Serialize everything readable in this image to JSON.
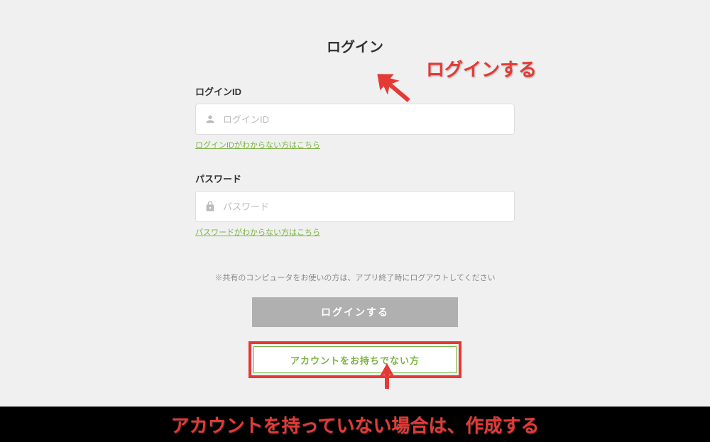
{
  "page": {
    "title": "ログイン"
  },
  "form": {
    "login_id": {
      "label": "ログインID",
      "placeholder": "ログインID",
      "value": "",
      "help_link": "ログインIDがわからない方はこちら"
    },
    "password": {
      "label": "パスワード",
      "placeholder": "パスワード",
      "value": "",
      "help_link": "パスワードがわからない方はこちら"
    }
  },
  "notice": "※共有のコンピュータをお使いの方は、アプリ終了時にログアウトしてください",
  "buttons": {
    "login": "ログインする",
    "signup": "アカウントをお持ちでない方"
  },
  "annotations": {
    "top": "ログインする",
    "bottom": "アカウントを持っていない場合は、作成する"
  }
}
